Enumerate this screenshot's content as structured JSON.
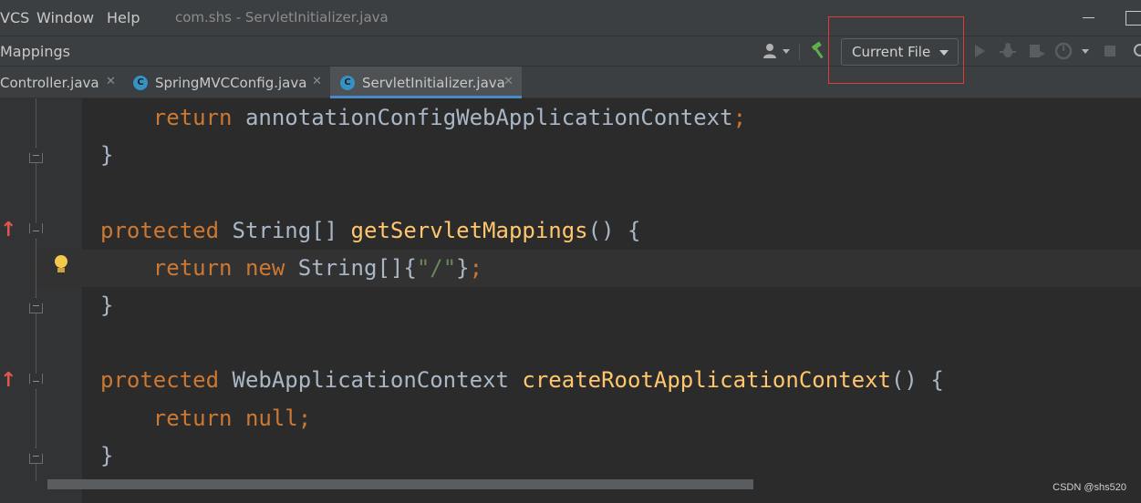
{
  "menubar": {
    "items": [
      "VCS",
      "Window",
      "Help"
    ],
    "title": "com.shs - ServletInitializer.java"
  },
  "toolbar": {
    "breadcrumb": "Mappings",
    "run_config": "Current File",
    "icons": [
      "user-icon",
      "build-hammer-icon",
      "run-icon",
      "debug-icon",
      "coverage-icon",
      "profile-icon",
      "stop-icon"
    ]
  },
  "tabs": [
    {
      "label": "Controller.java",
      "icon": "class-icon",
      "active": false
    },
    {
      "label": "SpringMVCConfig.java",
      "icon": "class-icon",
      "active": false
    },
    {
      "label": "ServletInitializer.java",
      "icon": "class-icon",
      "active": true
    }
  ],
  "editor": {
    "lines": [
      {
        "indent": "    ",
        "tokens": [
          {
            "t": "return",
            "c": "kw"
          },
          {
            "t": " annotationConfigWebApplicationContext",
            "c": "ty"
          },
          {
            "t": ";",
            "c": "kw"
          }
        ]
      },
      {
        "indent": "",
        "tokens": [
          {
            "t": "}",
            "c": "ty"
          }
        ]
      },
      {
        "indent": "",
        "tokens": []
      },
      {
        "indent": "",
        "tokens": [
          {
            "t": "protected",
            "c": "kw"
          },
          {
            "t": " String[] ",
            "c": "ty"
          },
          {
            "t": "getServletMappings",
            "c": "fn"
          },
          {
            "t": "() {",
            "c": "ty"
          }
        ]
      },
      {
        "indent": "    ",
        "tokens": [
          {
            "t": "return",
            "c": "kw"
          },
          {
            "t": " ",
            "c": "ty"
          },
          {
            "t": "new",
            "c": "kw"
          },
          {
            "t": " String[]{",
            "c": "ty"
          },
          {
            "t": "\"/\"",
            "c": "str"
          },
          {
            "t": "}",
            "c": "ty"
          },
          {
            "t": ";",
            "c": "kw"
          }
        ]
      },
      {
        "indent": "",
        "tokens": [
          {
            "t": "}",
            "c": "ty"
          }
        ]
      },
      {
        "indent": "",
        "tokens": []
      },
      {
        "indent": "",
        "tokens": [
          {
            "t": "protected",
            "c": "kw"
          },
          {
            "t": " WebApplicationContext ",
            "c": "ty"
          },
          {
            "t": "createRootApplicationContext",
            "c": "fn"
          },
          {
            "t": "() {",
            "c": "ty"
          }
        ]
      },
      {
        "indent": "    ",
        "tokens": [
          {
            "t": "return",
            "c": "kw"
          },
          {
            "t": " ",
            "c": "ty"
          },
          {
            "t": "null;",
            "c": "kw"
          }
        ]
      },
      {
        "indent": "",
        "tokens": [
          {
            "t": "}",
            "c": "ty"
          }
        ]
      }
    ]
  },
  "watermark": "CSDN @shs520",
  "colors": {
    "keyword": "#cc7832",
    "function": "#ffc66d",
    "string": "#6a8759",
    "identifier": "#a9b7c6",
    "highlight_box": "#e53935",
    "active_tab_underline": "#4a88c7"
  }
}
